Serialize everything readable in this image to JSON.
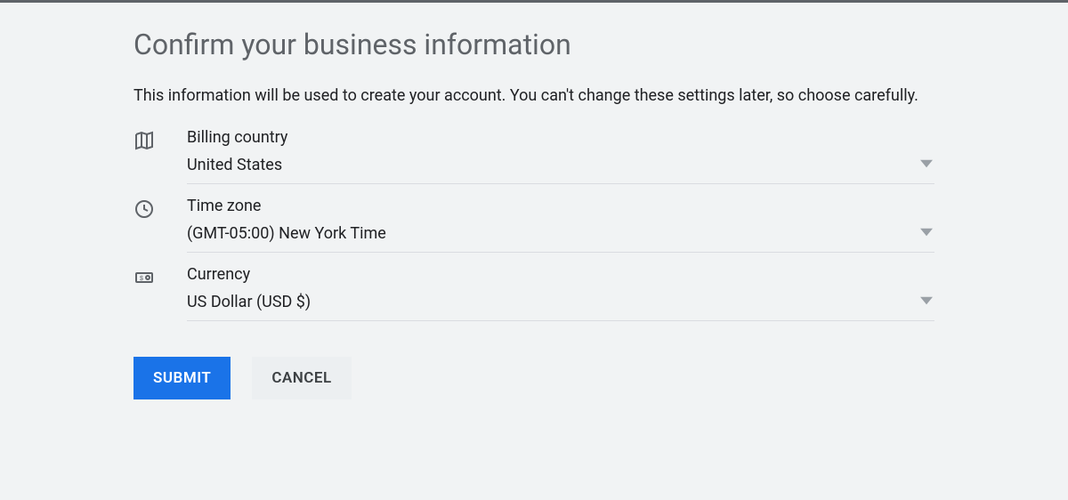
{
  "title": "Confirm your business information",
  "subtitle": "This information will be used to create your account. You can't change these settings later, so choose carefully.",
  "fields": {
    "billing_country": {
      "label": "Billing country",
      "value": "United States"
    },
    "time_zone": {
      "label": "Time zone",
      "value": "(GMT-05:00) New York Time"
    },
    "currency": {
      "label": "Currency",
      "value": "US Dollar (USD $)"
    }
  },
  "buttons": {
    "submit": "SUBMIT",
    "cancel": "CANCEL"
  }
}
